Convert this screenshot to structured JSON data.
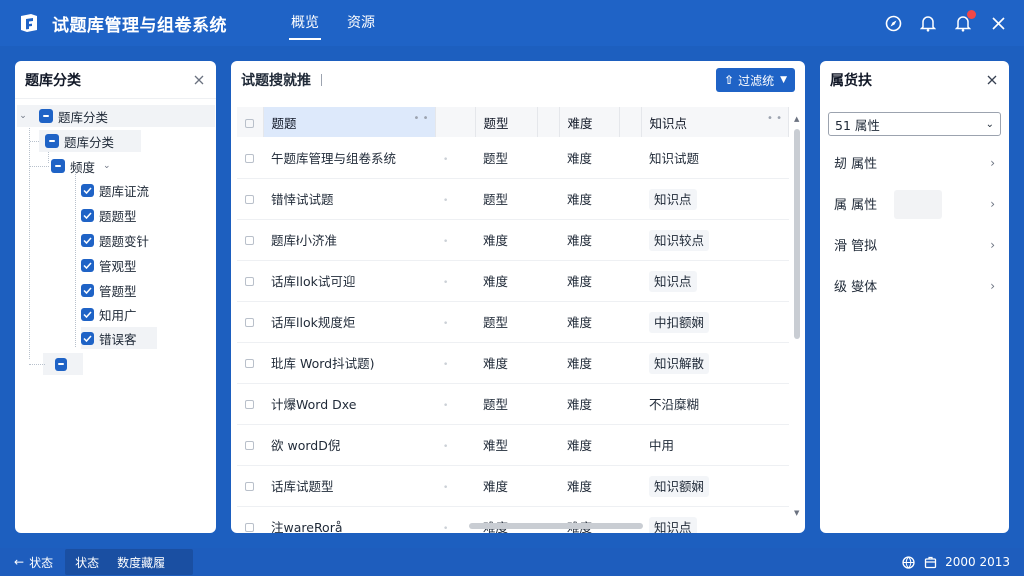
{
  "app": {
    "title": "试题库管理与组卷系统",
    "nav": [
      "概览",
      "资源"
    ]
  },
  "colors": {
    "brand": "#1f63c6",
    "badge": "#f04848"
  },
  "left_panel": {
    "title": "题库分类",
    "tree": [
      {
        "label": "题库分类",
        "level": 0
      },
      {
        "label": "题库分类",
        "level": 1
      },
      {
        "label": "频度",
        "level": 2
      },
      {
        "label": "题库证流",
        "level": 3
      },
      {
        "label": "题题型",
        "level": 3
      },
      {
        "label": "题题变针",
        "level": 3
      },
      {
        "label": "管观型",
        "level": 3
      },
      {
        "label": "管题型",
        "level": 3
      },
      {
        "label": "知用广",
        "level": 3
      },
      {
        "label": "错误客",
        "level": 3
      }
    ]
  },
  "mid_panel": {
    "title": "试题搜就推",
    "filter_label": "过滤统",
    "columns": [
      "题题",
      "题型",
      "难度",
      "知识点"
    ],
    "rows": [
      {
        "title": "午题库管理与组卷系统",
        "type": "题型",
        "difficulty": "难度",
        "knowledge": "知识试题"
      },
      {
        "title": "错悻试试题",
        "type": "题型",
        "difficulty": "难度",
        "knowledge": "知识点"
      },
      {
        "title": "题库ł小济准",
        "type": "难度",
        "difficulty": "难度",
        "knowledge": "知识较点"
      },
      {
        "title": "话库llok试可迎",
        "type": "难度",
        "difficulty": "难度",
        "knowledge": "知识点"
      },
      {
        "title": "话厍llok规度炬",
        "type": "题型",
        "difficulty": "难度",
        "knowledge": "中扣额娴"
      },
      {
        "title": "玭库 Word抖试题)",
        "type": "难度",
        "difficulty": "难度",
        "knowledge": "知识解散"
      },
      {
        "title": "计爆Word Dxe",
        "type": "题型",
        "difficulty": "难度",
        "knowledge": "不沿糜糊"
      },
      {
        "title": "欲 wordD倪",
        "type": "难型",
        "difficulty": "难度",
        "knowledge": "中用"
      },
      {
        "title": "话库试题型",
        "type": "难度",
        "difficulty": "难度",
        "knowledge": "知识额娴"
      },
      {
        "title": "注wareRorå",
        "type": "难度",
        "difficulty": "难度",
        "knowledge": "知识点"
      }
    ]
  },
  "right_panel": {
    "title": "属货扶",
    "select_value": "51 属性",
    "items": [
      "刼 属性",
      "属 属性",
      "滑 管拟",
      "级 燮体"
    ]
  },
  "bottom": {
    "back": "状态",
    "status": [
      "状态",
      "数度藏履"
    ],
    "version": "2000 2013"
  }
}
